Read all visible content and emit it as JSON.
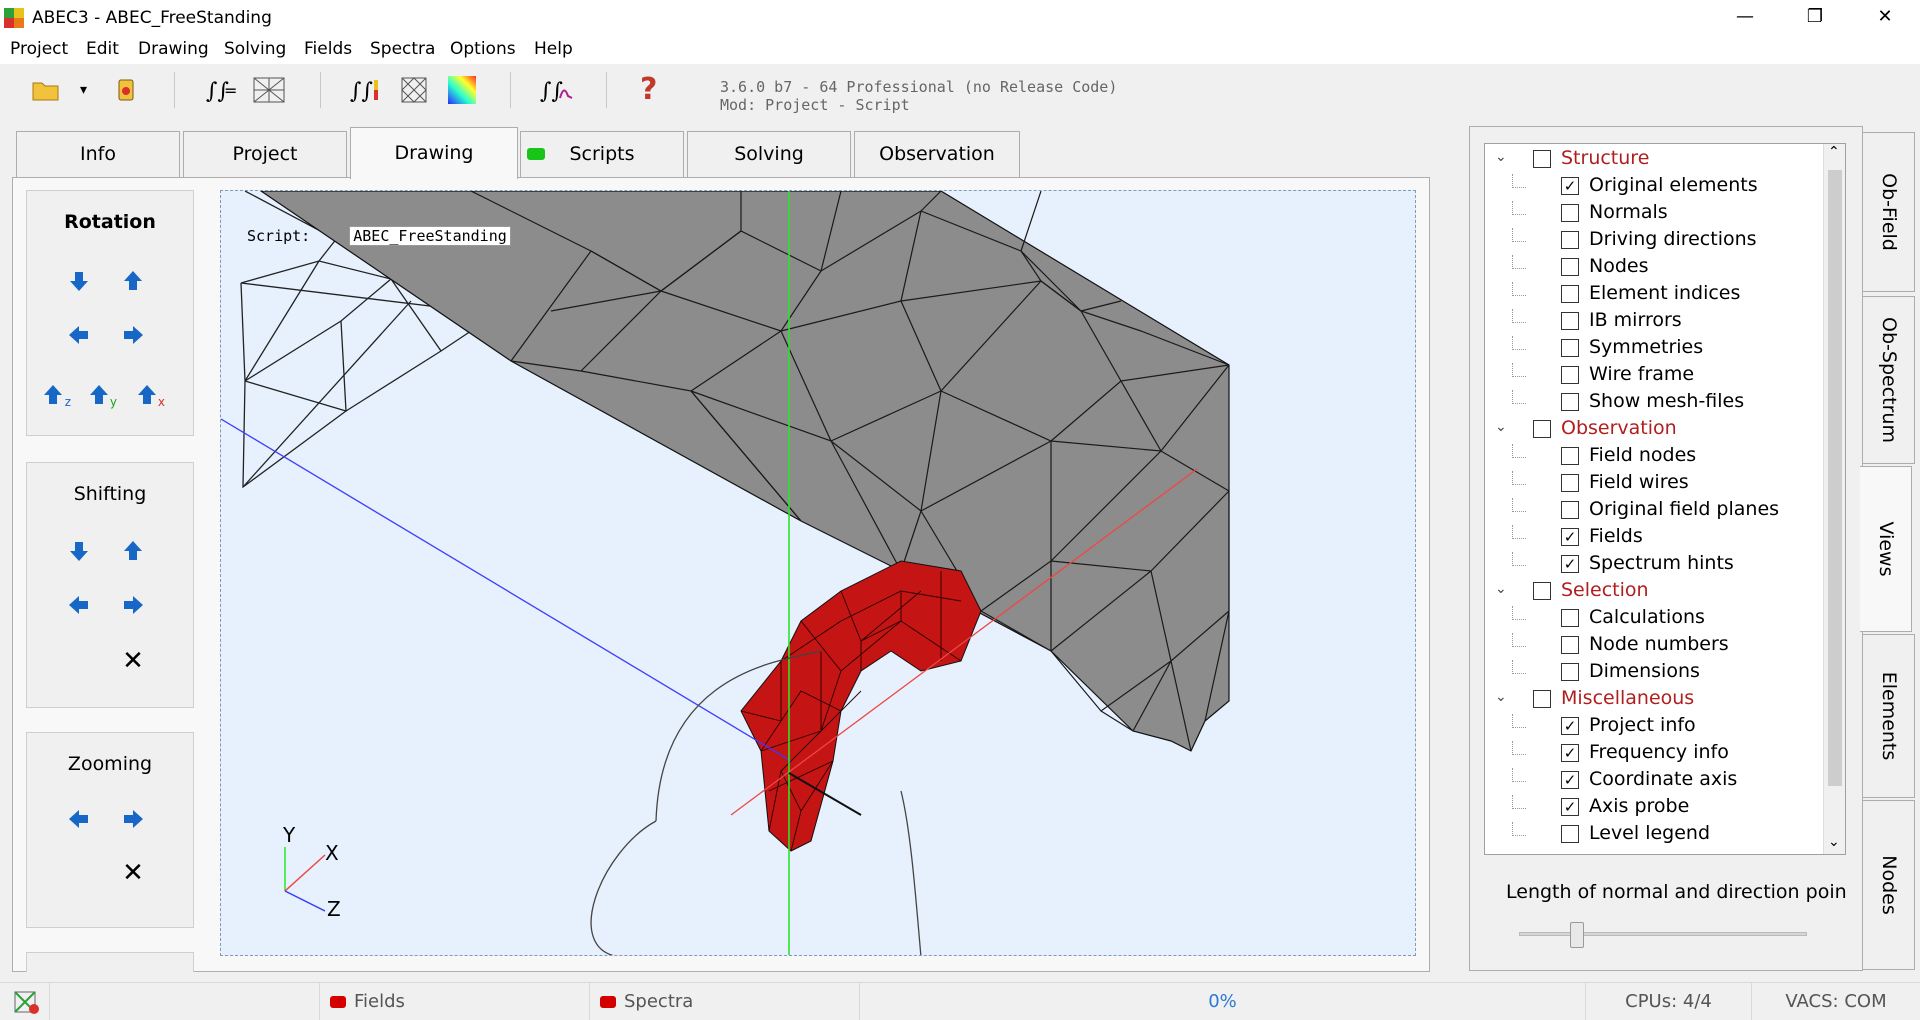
{
  "window": {
    "title": "ABEC3 - ABEC_FreeStanding",
    "minimize_glyph": "—",
    "restore_glyph": "❐",
    "close_glyph": "✕"
  },
  "menu": [
    "Project",
    "Edit",
    "Drawing",
    "Solving",
    "Fields",
    "Spectra",
    "Options",
    "Help"
  ],
  "toolbar": {
    "version_line1": "3.6.0 b7 - 64 Professional (no Release Code)",
    "version_line2": "Mod: Project - Script",
    "dropdown_glyph": "▾",
    "help_glyph": "?"
  },
  "tabs": [
    {
      "label": "Info"
    },
    {
      "label": "Project"
    },
    {
      "label": "Drawing",
      "active": true
    },
    {
      "label": "Scripts",
      "indicator_color": "#19c419"
    },
    {
      "label": "Solving"
    },
    {
      "label": "Observation"
    }
  ],
  "controls": {
    "rotation_title": "Rotation",
    "shifting_title": "Shifting",
    "zooming_title": "Zooming",
    "reset_glyph": "✕",
    "axis_z": "z",
    "axis_y": "y",
    "axis_x": "x"
  },
  "viewport": {
    "script_label": "Script:",
    "script_name": "ABEC_FreeStanding",
    "axis_y": "Y",
    "axis_x": "X",
    "axis_z": "Z",
    "colors": {
      "background": "#e6f1fd",
      "mesh_gray": "#8c8c8c",
      "mesh_red": "#c41414",
      "axis_blue": "#3a3aff",
      "axis_red": "#f04646",
      "axis_green": "#28e628"
    }
  },
  "tree": {
    "chevron_glyph": "⌄",
    "check_glyph": "✓",
    "rows": [
      {
        "label": "Structure",
        "group": true,
        "checked": false
      },
      {
        "label": "Original elements",
        "checked": true
      },
      {
        "label": "Normals",
        "checked": false
      },
      {
        "label": "Driving directions",
        "checked": false
      },
      {
        "label": "Nodes",
        "checked": false
      },
      {
        "label": "Element indices",
        "checked": false
      },
      {
        "label": "IB mirrors",
        "checked": false
      },
      {
        "label": "Symmetries",
        "checked": false
      },
      {
        "label": "Wire frame",
        "checked": false
      },
      {
        "label": "Show mesh-files",
        "checked": false
      },
      {
        "label": "Observation",
        "group": true,
        "checked": false
      },
      {
        "label": "Field nodes",
        "checked": false
      },
      {
        "label": "Field wires",
        "checked": false
      },
      {
        "label": "Original field planes",
        "checked": false
      },
      {
        "label": "Fields",
        "checked": true
      },
      {
        "label": "Spectrum hints",
        "checked": true
      },
      {
        "label": "Selection",
        "group": true,
        "checked": false
      },
      {
        "label": "Calculations",
        "checked": false
      },
      {
        "label": "Node numbers",
        "checked": false
      },
      {
        "label": "Dimensions",
        "checked": false
      },
      {
        "label": "Miscellaneous",
        "group": true,
        "checked": false
      },
      {
        "label": "Project info",
        "checked": true
      },
      {
        "label": "Frequency info",
        "checked": true
      },
      {
        "label": "Coordinate axis",
        "checked": true
      },
      {
        "label": "Axis probe",
        "checked": true
      },
      {
        "label": "Level legend",
        "checked": false
      }
    ],
    "scroll_up_glyph": "⌃",
    "scroll_down_glyph": "⌄"
  },
  "length_label": "Length of normal and direction poin",
  "slider": {
    "value_fraction": 0.2
  },
  "side_tabs": [
    "Ob-Field",
    "Ob-Spectrum",
    "Views",
    "Elements",
    "Nodes"
  ],
  "active_side_tab": "Views",
  "status": {
    "fields": "Fields",
    "spectra": "Spectra",
    "progress": "0%",
    "cpus": "CPUs: 4/4",
    "vacs": "VACS: COM"
  }
}
